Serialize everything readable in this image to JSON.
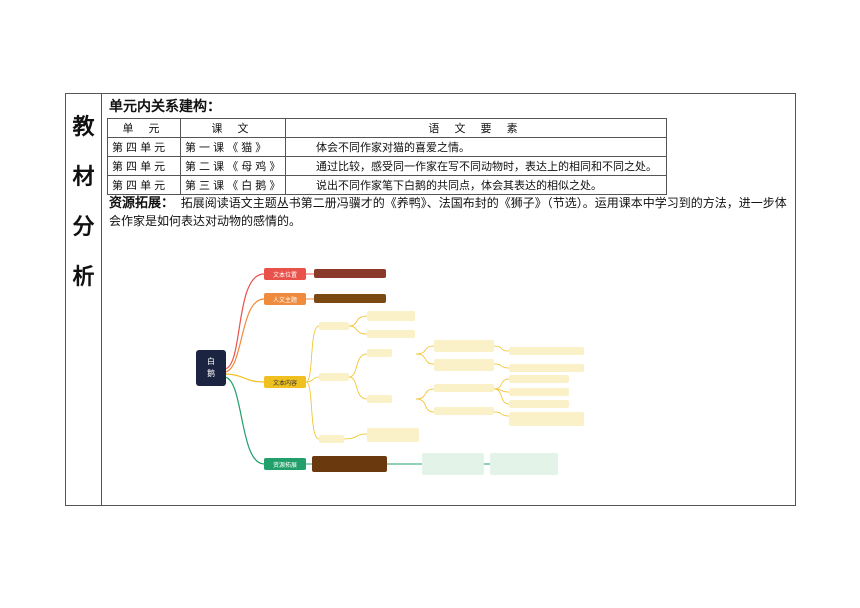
{
  "side_chars": [
    "教",
    "材",
    "分",
    "析"
  ],
  "heading": "单元内关系建构：",
  "table": {
    "headers": [
      "单 元",
      "课 文",
      "语 文 要 素"
    ],
    "rows": [
      [
        "第 四 单 元",
        "第 一 课 《 猫 》",
        "体会不同作家对猫的喜爱之情。"
      ],
      [
        "第 四 单 元",
        "第 二 课 《 母 鸡 》",
        "通过比较，感受同一作家在写不同动物时，表达上的相同和不同之处。"
      ],
      [
        "第 四 单 元",
        "第 三 课 《 白 鹅 》",
        "说出不同作家笔下白鹅的共同点，体会其表达的相似之处。"
      ]
    ]
  },
  "resource": {
    "label": "资源拓展：",
    "text": "拓展阅读语文主题丛书第二册冯骥才的《养鸭》、法国布封的《狮子》（节选）。运用课本中学习到的方法，进一步体会作家是如何表达对动物的感情的。"
  },
  "mindmap": {
    "root": "白鹅",
    "branches": [
      {
        "label": "文本位置",
        "color": "#e8524a"
      },
      {
        "label": "人文主题",
        "color": "#f08a3c"
      },
      {
        "label": "文本内容",
        "color": "#f0c020"
      },
      {
        "label": "资源拓展",
        "color": "#22a06b"
      }
    ]
  }
}
